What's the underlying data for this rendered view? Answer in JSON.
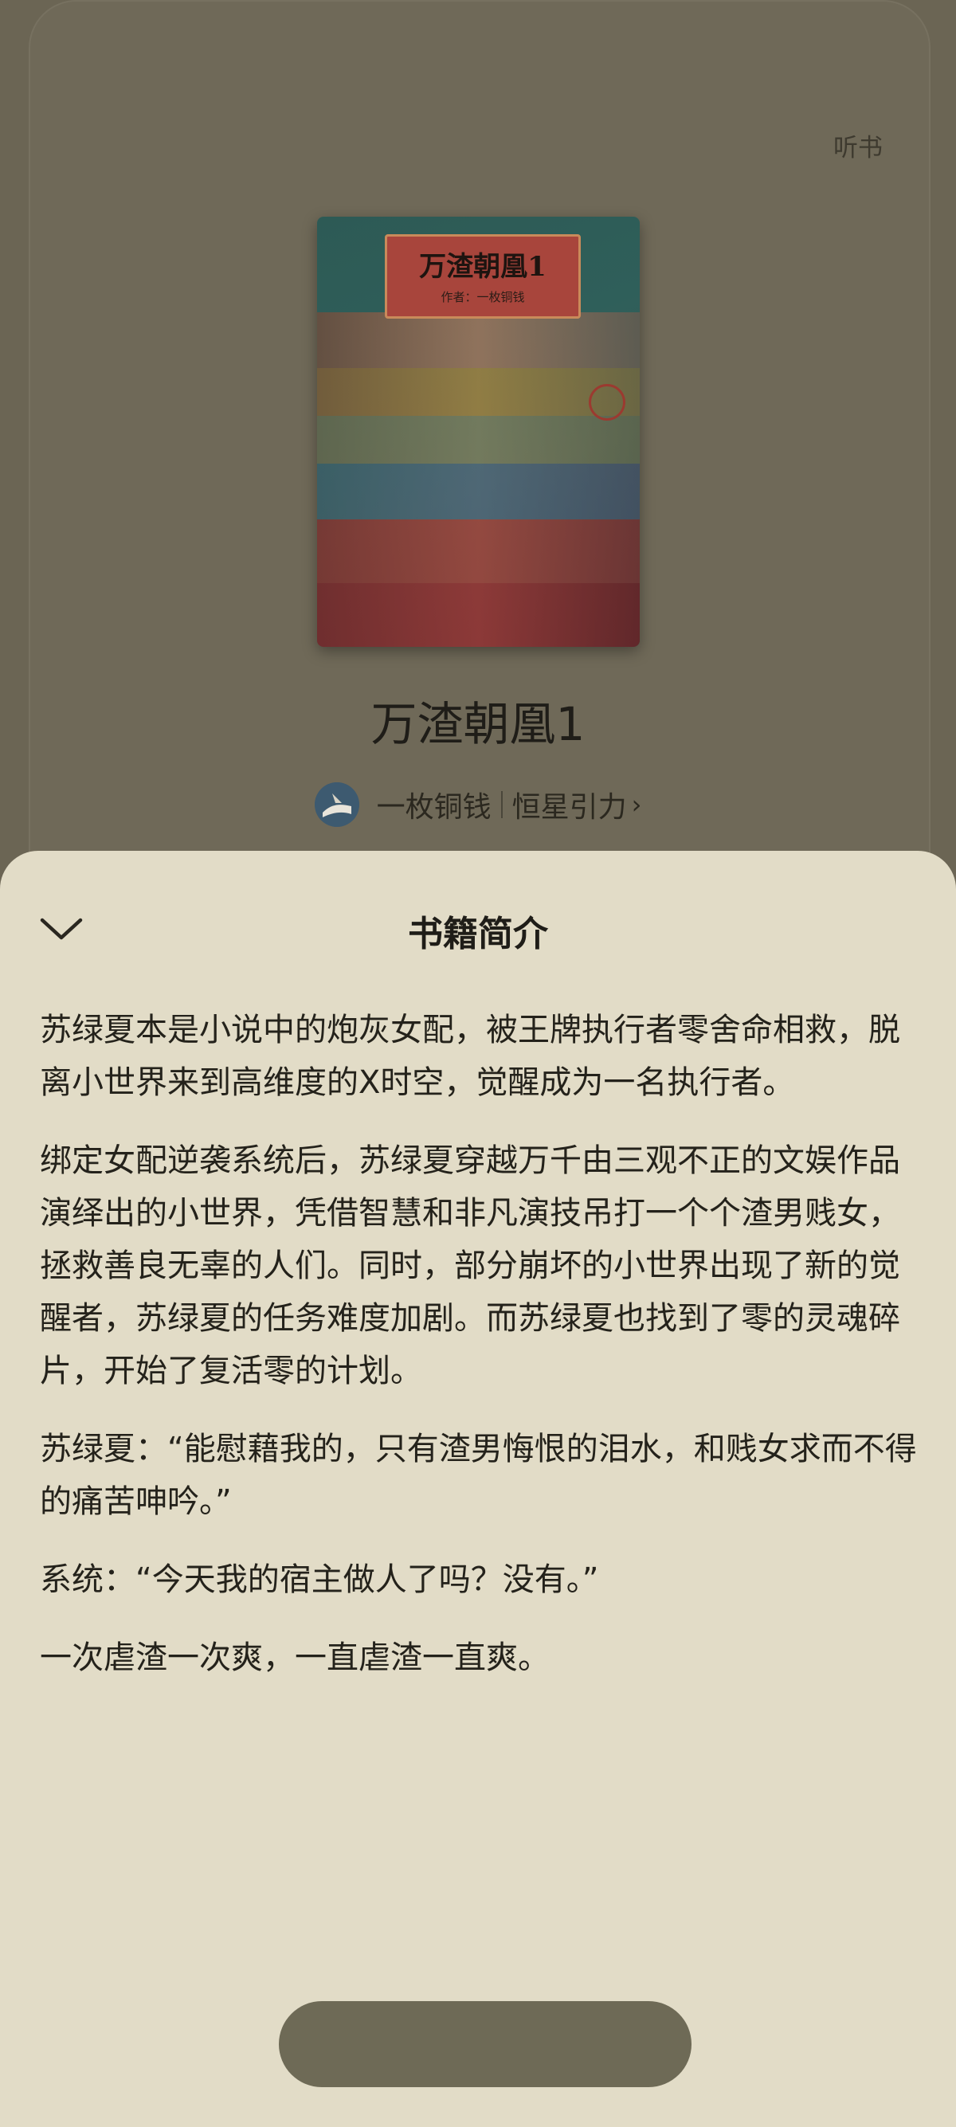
{
  "header": {
    "listen_label": "听书"
  },
  "book": {
    "cover_title": "万渣朝凰1",
    "cover_subtitle": "作者：一枚铜钱",
    "title": "万渣朝凰1",
    "author": "一枚铜钱",
    "publisher": "恒星引力",
    "publisher_chevron": "›"
  },
  "sheet": {
    "title": "书籍简介",
    "paragraphs": [
      "苏绿夏本是小说中的炮灰女配，被王牌执行者零舍命相救，脱离小世界来到高维度的X时空，觉醒成为一名执行者。",
      "绑定女配逆袭系统后，苏绿夏穿越万千由三观不正的文娱作品演绎出的小世界，凭借智慧和非凡演技吊打一个个渣男贱女，拯救善良无辜的人们。同时，部分崩坏的小世界出现了新的觉醒者，苏绿夏的任务难度加剧。而苏绿夏也找到了零的灵魂碎片，开始了复活零的计划。",
      "苏绿夏：“能慰藉我的，只有渣男悔恨的泪水，和贱女求而不得的痛苦呻吟。”",
      "系统：“今天我的宿主做人了吗？没有。”",
      "一次虐渣一次爽，一直虐渣一直爽。"
    ]
  },
  "colors": {
    "overlay_bg": "#6b6554",
    "sheet_bg": "#e2dcc7",
    "pill_bg": "#6e6a56"
  }
}
